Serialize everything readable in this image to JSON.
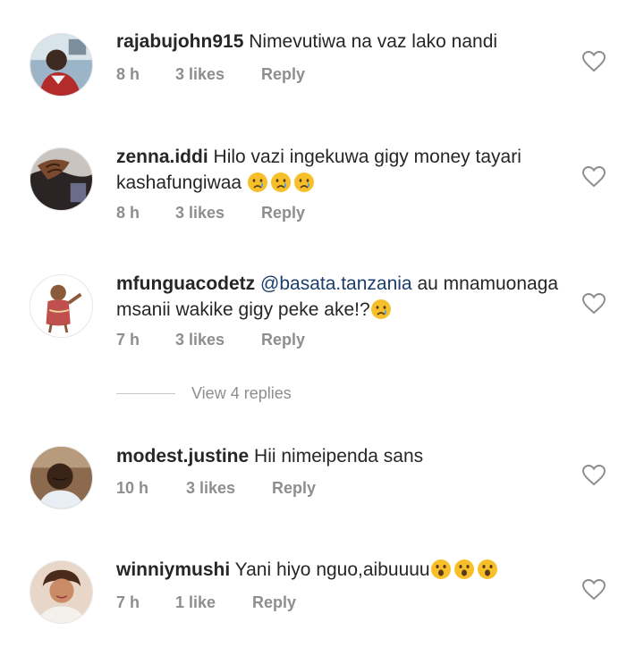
{
  "comments": [
    {
      "username": "rajabujohn915",
      "text": "Nimevutiwa na vaz lako nandi",
      "time": "8 h",
      "likes": "3 likes",
      "reply": "Reply",
      "emojis": []
    },
    {
      "username": "zenna.iddi",
      "text": "Hilo vazi ingekuwa gigy money tayari kashafungiwaa",
      "time": "8 h",
      "likes": "3 likes",
      "reply": "Reply",
      "emojis": [
        "crying-face",
        "crying-face",
        "crying-face"
      ]
    },
    {
      "username": "mfunguacodetz",
      "mention": "@basata.tanzania",
      "text": "au mnamuonaga msanii wakike gigy peke ake!?",
      "time": "7 h",
      "likes": "3 likes",
      "reply": "Reply",
      "emojis": [
        "crying-face"
      ]
    },
    {
      "username": "modest.justine",
      "text": "Hii nimeipenda sans",
      "time": "10 h",
      "likes": "3 likes",
      "reply": "Reply",
      "emojis": []
    },
    {
      "username": "winniymushi",
      "text": "Yani hiyo nguo,aibuuuu",
      "time": "7 h",
      "likes": "1 like",
      "reply": "Reply",
      "emojis": [
        "astonished-face",
        "astonished-face",
        "astonished-face"
      ]
    }
  ],
  "view_replies": "View 4 replies",
  "icons": {
    "like": "heart-outline-icon"
  },
  "colors": {
    "text": "#262626",
    "meta": "#8e8e8e",
    "mention": "#1a3d6e",
    "emoji": "#f7c02b"
  }
}
